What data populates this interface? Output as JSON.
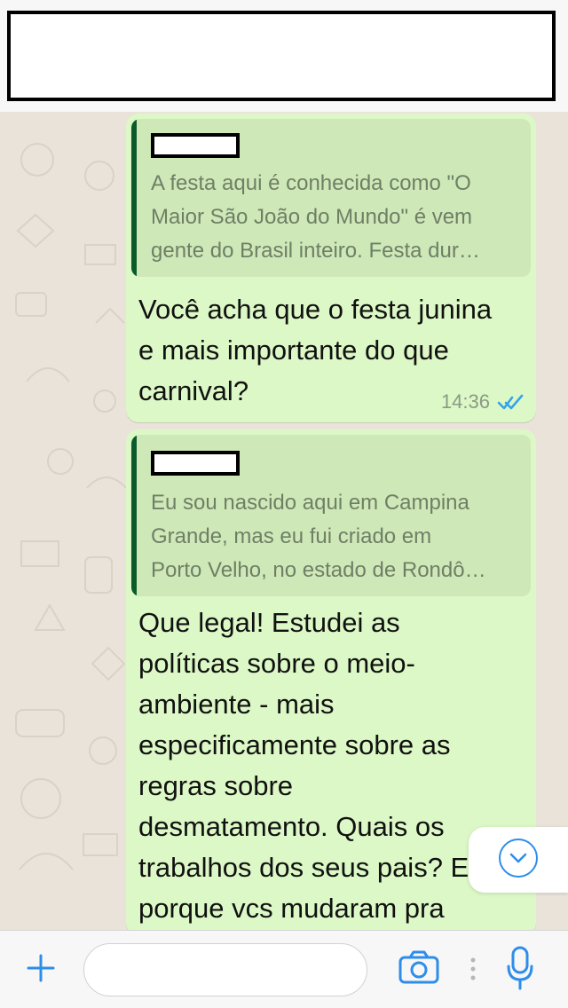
{
  "header": {
    "contact_name": ""
  },
  "messages": [
    {
      "reply_to": {
        "sender": "",
        "text": "A festa aqui é conhecida como \"O\nMaior São João do Mundo\" é vem\ngente do Brasil inteiro. Festa dur…"
      },
      "text": "Você acha que o festa junina\ne mais importante do que\ncarnival?",
      "time": "14:36",
      "status_icon": "double-check-icon"
    },
    {
      "reply_to": {
        "sender": "",
        "text": "Eu sou nascido aqui em Campina\nGrande, mas eu fui criado em\nPorto Velho, no estado de Rondô…"
      },
      "text": "Que legal! Estudei as\npolíticas sobre o meio-\nambiente - mais\nespecificamente sobre as\nregras sobre\ndesmatamento. Quais os\ntrabalhos dos seus pais? E\nporque vcs mudaram pra"
    }
  ],
  "composer": {
    "input_value": "",
    "placeholder": "",
    "plus_icon": "plus-icon",
    "camera_icon": "camera-icon",
    "mic_icon": "microphone-icon",
    "scroll_icon": "chevron-down-icon"
  },
  "colors": {
    "outgoing_bubble": "#dcf8c6",
    "quoted_bg": "#cfe8b8",
    "quote_bar": "#0b5b2a",
    "accent_blue": "#2f8dea",
    "chat_background": "#e9e3d9"
  }
}
